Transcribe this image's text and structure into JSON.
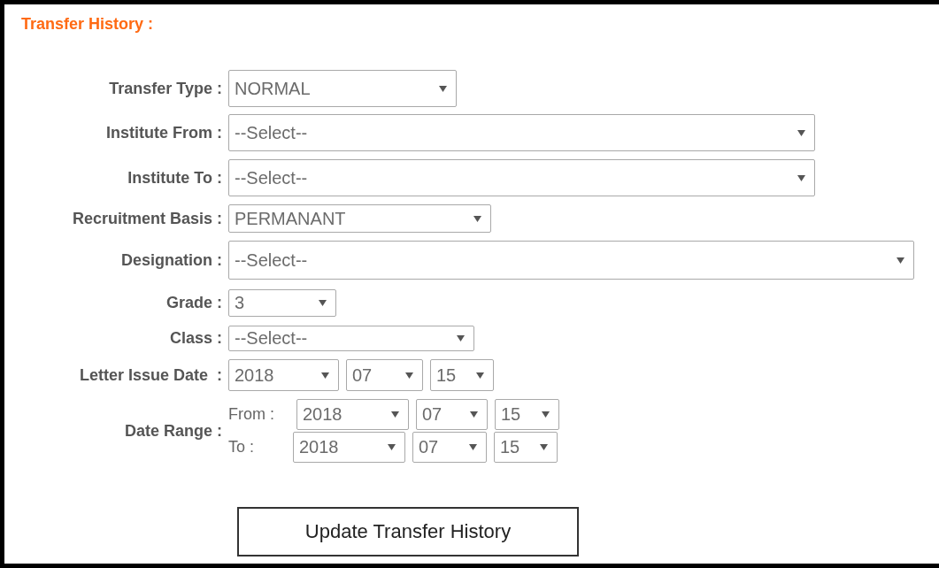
{
  "section_title": "Transfer History :",
  "fields": [
    {
      "kind": "select",
      "label": "Transfer Type :",
      "value": "NORMAL"
    },
    {
      "kind": "select",
      "label": "Institute From :",
      "value": "--Select--"
    },
    {
      "kind": "select",
      "label": "Institute To :",
      "value": "--Select--"
    },
    {
      "kind": "select",
      "label": "Recruitment Basis :",
      "value": "PERMANANT"
    },
    {
      "kind": "select",
      "label": "Designation :",
      "value": "--Select--"
    },
    {
      "kind": "select",
      "label": "Grade :",
      "value": "3"
    },
    {
      "kind": "select",
      "label": "Class :",
      "value": "--Select--"
    },
    {
      "kind": "date",
      "label": "Letter Issue Date  :",
      "parts": [
        "2018",
        "07",
        "15"
      ]
    },
    {
      "kind": "date_range",
      "label": "Date Range :",
      "ranges": [
        {
          "label": "From :",
          "parts": [
            "2018",
            "07",
            "15"
          ]
        },
        {
          "label": "To :",
          "parts": [
            "2018",
            "07",
            "15"
          ]
        }
      ]
    }
  ],
  "submit_button": {
    "label": "Update Transfer History"
  }
}
